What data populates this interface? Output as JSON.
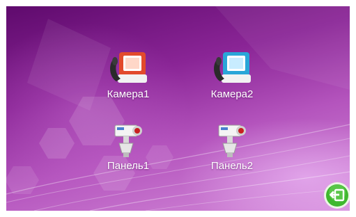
{
  "tiles": [
    {
      "label": "Камера1",
      "icon": "intercom-monitor-red-icon"
    },
    {
      "label": "Камера2",
      "icon": "intercom-monitor-blue-icon"
    },
    {
      "label": "Панель1",
      "icon": "security-camera-icon"
    },
    {
      "label": "Панель2",
      "icon": "security-camera-icon"
    }
  ],
  "back_button": {
    "icon": "back-arrow-icon"
  },
  "colors": {
    "background_dark": "#5f0a6d",
    "background_light": "#d58edb",
    "back_button": "#3fb82e",
    "monitor_red": "#e0402a",
    "monitor_blue": "#2aa6d8"
  }
}
